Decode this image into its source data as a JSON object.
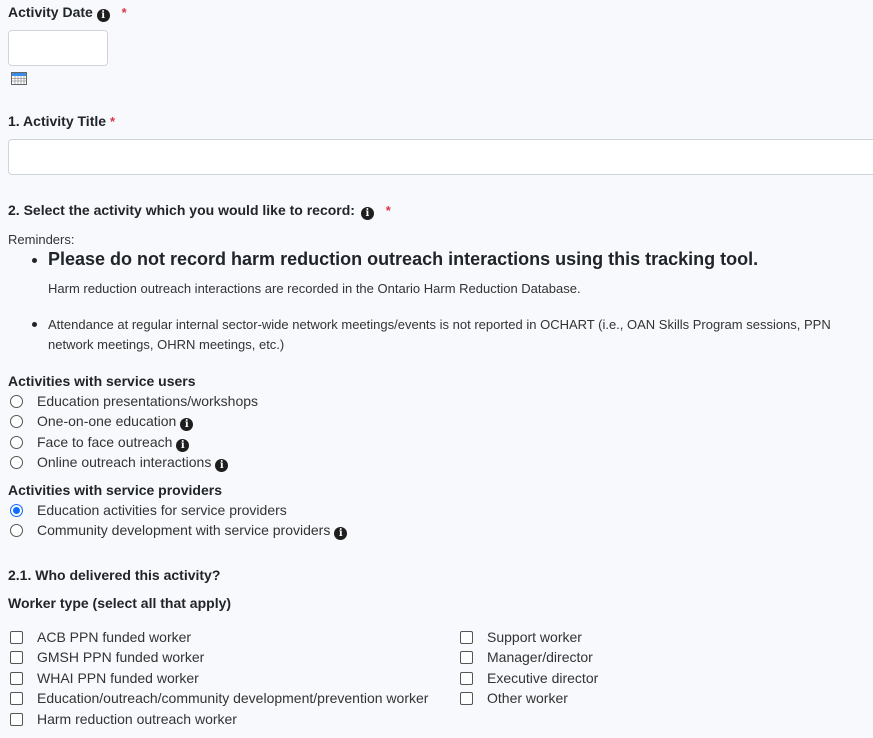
{
  "activity_date": {
    "label": "Activity Date",
    "required_mark": "*",
    "value": "",
    "icons": {
      "info": "info-icon",
      "calendar": "calendar-icon"
    }
  },
  "activity_title": {
    "label": "1. Activity Title",
    "required_mark": "*",
    "value": ""
  },
  "select_activity": {
    "label": "2. Select the activity which you would like to record:",
    "required_mark": "*",
    "reminders_label": "Reminders:",
    "reminders": [
      {
        "headline": "Please do not record harm reduction outreach interactions using this tracking tool.",
        "detail": "Harm reduction outreach interactions are recorded in the Ontario Harm Reduction Database."
      },
      {
        "text_line1": "Attendance at regular internal sector-wide network meetings/events is not reported in OCHART (i.e., OAN Skills Program sessions, PPN",
        "text_line2": "network meetings, OHRN meetings, etc.)"
      }
    ],
    "groups": [
      {
        "heading": "Activities with service users",
        "options": [
          {
            "label": "Education presentations/workshops",
            "checked": false,
            "info": false
          },
          {
            "label": "One-on-one education",
            "checked": false,
            "info": true
          },
          {
            "label": "Face to face outreach",
            "checked": false,
            "info": true
          },
          {
            "label": "Online outreach interactions",
            "checked": false,
            "info": true
          }
        ]
      },
      {
        "heading": "Activities with service providers",
        "options": [
          {
            "label": "Education activities for service providers",
            "checked": true,
            "info": false
          },
          {
            "label": "Community development with service providers",
            "checked": false,
            "info": true
          }
        ]
      }
    ]
  },
  "who_delivered": {
    "label": "2.1. Who delivered this activity?",
    "worker_type_label": "Worker type (select all that apply)",
    "left_options": [
      {
        "label": "ACB PPN funded worker",
        "checked": false
      },
      {
        "label": "GMSH PPN funded worker",
        "checked": false
      },
      {
        "label": "WHAI PPN funded worker",
        "checked": false
      },
      {
        "label": "Education/outreach/community development/prevention worker",
        "checked": false
      },
      {
        "label": "Harm reduction outreach worker",
        "checked": false
      }
    ],
    "right_options": [
      {
        "label": "Support worker",
        "checked": false
      },
      {
        "label": "Manager/director",
        "checked": false
      },
      {
        "label": "Executive director",
        "checked": false
      },
      {
        "label": "Other worker",
        "checked": false
      }
    ]
  },
  "colors": {
    "required": "#dc3545",
    "radio_checked": "#0d6efd",
    "background": "#f8f9fd"
  }
}
